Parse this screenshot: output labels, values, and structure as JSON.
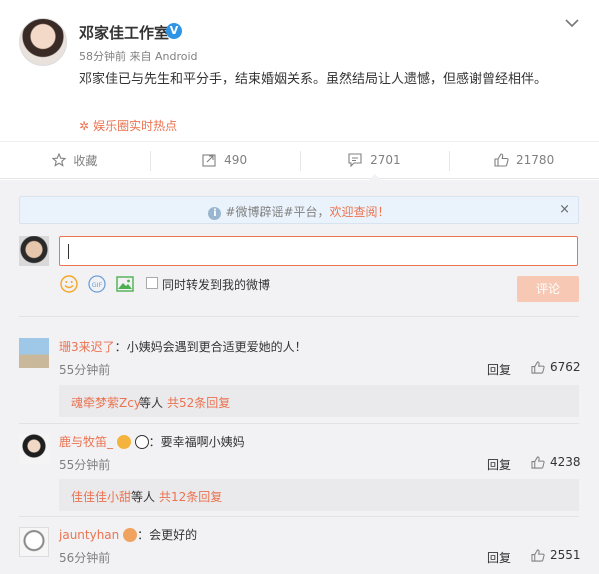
{
  "post": {
    "author": "邓家佳工作室",
    "verified_badge": "V",
    "meta": "58分钟前 来自 Android",
    "content": "邓家佳已与先生和平分手，结束婚姻关系。虽然结局让人遗憾，但感谢曾经相伴。",
    "hot_tag": "娱乐圈实时热点"
  },
  "actions": {
    "favorite": "收藏",
    "repost": "490",
    "comment": "2701",
    "like": "21780"
  },
  "notice": {
    "text": "#微博辟谣#平台，",
    "link": "欢迎查阅！",
    "info_icon": "i",
    "close": "×"
  },
  "composer": {
    "repost_label": "同时转发到我的微博",
    "submit": "评论"
  },
  "comments": [
    {
      "user": "珊3来迟了",
      "text": "：小姨妈会遇到更合适更爱她的人！",
      "time": "55分钟前",
      "reply": "回复",
      "likes": "6762",
      "sub_user": "魂牵梦萦Zcy",
      "sub_mid": " 等人 ",
      "sub_count": "共52条回复"
    },
    {
      "user": "鹿与牧笛_",
      "text": "：要幸福啊小姨妈",
      "time": "55分钟前",
      "reply": "回复",
      "likes": "4238",
      "sub_user": "佳佳佳小甜",
      "sub_mid": " 等人 ",
      "sub_count": "共12条回复"
    },
    {
      "user": "jauntyhan",
      "text": "：会更好的",
      "time": "56分钟前",
      "reply": "回复",
      "likes": "2551"
    }
  ],
  "colors": {
    "accent": "#eb7350",
    "verified": "#2e95e6",
    "comment_bg": "#f2f2f5"
  }
}
